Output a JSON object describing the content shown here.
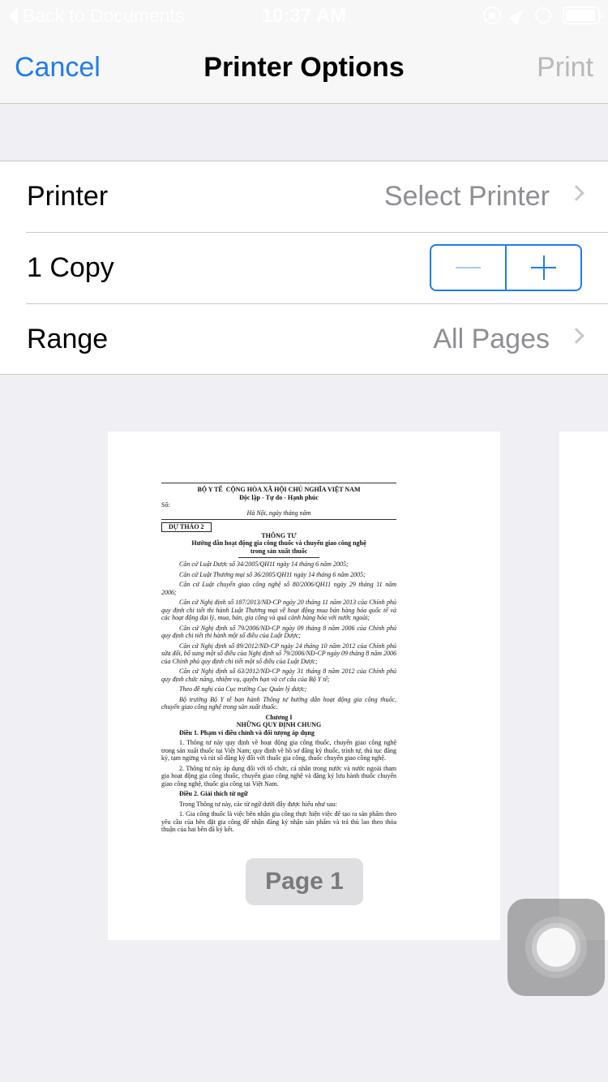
{
  "status": {
    "back_label": "Back to Documents",
    "time": "10:37 AM"
  },
  "nav": {
    "cancel": "Cancel",
    "title": "Printer Options",
    "print": "Print"
  },
  "options": {
    "printer": {
      "label": "Printer",
      "value": "Select Printer"
    },
    "copies": {
      "label": "1 Copy",
      "count": 1
    },
    "range": {
      "label": "Range",
      "value": "All Pages"
    }
  },
  "preview": {
    "page_badge": "Page 1",
    "doc": {
      "header_left": "BỘ Y TẾ",
      "header_right": "CỘNG HÒA XÃ HỘI CHỦ NGHĨA VIỆT NAM",
      "motto": "Độc lập - Tự do - Hạnh phúc",
      "number": "Số:",
      "place_date": "Hà Nội, ngày      tháng      năm",
      "draft": "DỰ THẢO 2",
      "doc_type": "THÔNG TƯ",
      "subject_1": "Hướng dẫn hoạt động gia công thuốc và chuyển giao công nghệ",
      "subject_2": "trong sản xuất thuốc",
      "p1": "Căn cứ Luật Dược số 34/2005/QH11 ngày 14 tháng 6 năm 2005;",
      "p2": "Căn cứ Luật Thương mại số 36/2005/QH11 ngày 14 tháng 6 năm 2005;",
      "p3": "Căn cứ Luật chuyển giao công nghệ số 80/2006/QH11 ngày 29 tháng 11 năm 2006;",
      "p4": "Căn cứ Nghị định số 187/2013/NĐ-CP ngày 20 tháng 11 năm 2013 của Chính phủ quy định chi tiết thi hành Luật Thương mại về hoạt động mua bán hàng hóa quốc tế và các hoạt động đại lý, mua, bán, gia công và quá cảnh hàng hóa với nước ngoài;",
      "p5": "Căn cứ Nghị định số 79/2006/NĐ-CP ngày 09 tháng 8 năm 2006 của Chính phủ quy định chi tiết thi hành một số điều của Luật Dược;",
      "p6": "Căn cứ Nghị định số 89/2012/NĐ-CP ngày 24 tháng 10 năm 2012 của Chính phủ sửa đổi, bổ sung một số điều của Nghị định số 79/2006/NĐ-CP ngày 09 tháng 8 năm 2006 của Chính phủ quy định chi tiết một số điều của Luật Dược;",
      "p7": "Căn cứ Nghị định số 63/2012/NĐ-CP ngày 31 tháng 8 năm 2012 của Chính phủ quy định chức năng, nhiệm vụ, quyền hạn và cơ cấu của Bộ Y tế;",
      "p8": "Theo đề nghị của Cục trưởng Cục Quản lý dược;",
      "p9": "Bộ trưởng Bộ Y tế ban hành Thông tư hướng dẫn hoạt động gia công thuốc, chuyển giao công nghệ trong sản xuất thuốc.",
      "chapter": "Chương I",
      "chapter_title": "NHỮNG QUY ĐỊNH CHUNG",
      "art1": "Điều 1. Phạm vi điều chỉnh và đối tượng áp dụng",
      "a1p1": "1. Thông tư này quy định về hoạt động gia công thuốc, chuyển giao công nghệ trong sản xuất thuốc tại Việt Nam; quy định về hồ sơ đăng ký thuốc, trình tự, thủ tục đăng ký, tạm ngừng và rút số đăng ký đối với thuốc gia công, thuốc chuyển giao công nghệ.",
      "a1p2": "2. Thông tư này áp dụng đối với tổ chức, cá nhân trong nước và nước ngoài tham gia hoạt động gia công thuốc, chuyển giao công nghệ và đăng ký lưu hành thuốc chuyển giao công nghệ, thuốc gia công tại Việt Nam.",
      "art2": "Điều 2. Giải thích từ ngữ",
      "a2p0": "Trong Thông tư này, các từ ngữ dưới đây được hiểu như sau:",
      "a2p1": "1. Gia công thuốc là việc bên nhận gia công thực hiện việc để tạo ra sản phẩm theo yêu cầu của bên đặt gia công để nhận đăng ký nhận sản phẩm và trả thù lao theo thỏa thuận của hai bên đã ký kết."
    }
  }
}
